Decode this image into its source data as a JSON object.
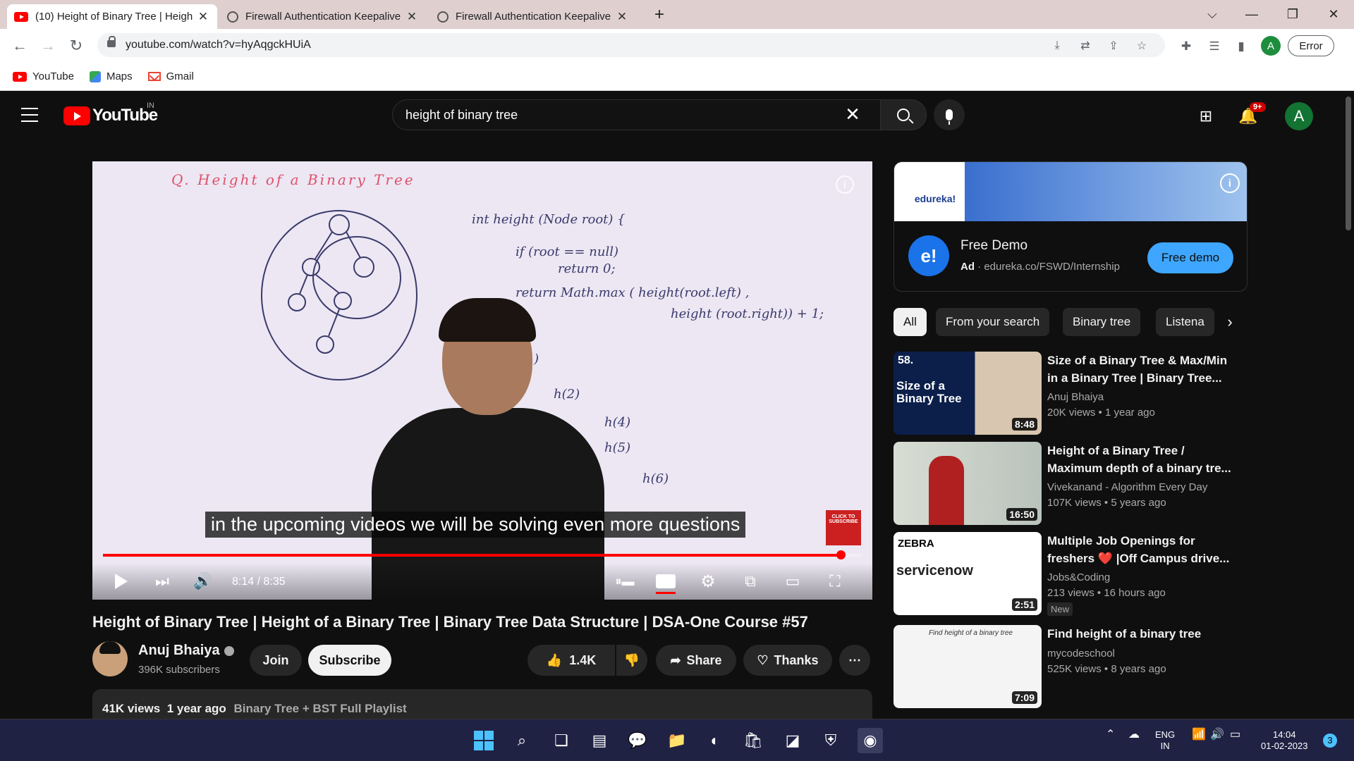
{
  "browser": {
    "tabs": [
      {
        "title": "(10) Height of Binary Tree | Heigh",
        "active": true
      },
      {
        "title": "Firewall Authentication Keepalive",
        "active": false
      },
      {
        "title": "Firewall Authentication Keepalive",
        "active": false
      }
    ],
    "new_tab": "+",
    "url": "youtube.com/watch?v=hyAqgckHUiA",
    "profile_initial": "A",
    "error_label": "Error",
    "bookmarks": [
      {
        "label": "YouTube",
        "icon": "youtube-icon"
      },
      {
        "label": "Maps",
        "icon": "maps-icon"
      },
      {
        "label": "Gmail",
        "icon": "gmail-icon"
      }
    ]
  },
  "header": {
    "logo_text": "YouTube",
    "country": "IN",
    "search_value": "height of binary tree",
    "notifications": "9+",
    "avatar_initial": "A"
  },
  "player": {
    "whiteboard_title": "Q. Height of a Binary Tree",
    "whiteboard_code": [
      "int height (Node root) {",
      "if (root == null)",
      "return 0;",
      "return Math.max ( height(root.left) ,",
      "height (root.right)) + 1;"
    ],
    "whiteboard_calls": [
      "h(1)",
      "h(2)",
      "h(4)",
      "h(5)",
      "h(6)"
    ],
    "caption": "in the upcoming videos we will be solving even more questions",
    "subscribe_overlay": "CLICK TO SUBSCRIBE",
    "current_time": "8:14",
    "duration": "8:35",
    "progress": 0.9725
  },
  "video": {
    "title": "Height of Binary Tree | Height of a Binary Tree | Binary Tree Data Structure | DSA-One Course #57",
    "channel": "Anuj Bhaiya",
    "subscribers": "396K subscribers",
    "join_label": "Join",
    "subscribe_label": "Subscribe",
    "likes": "1.4K",
    "share_label": "Share",
    "thanks_label": "Thanks",
    "views": "41K views",
    "age": "1 year ago",
    "playlist": "Binary Tree + BST Full Playlist"
  },
  "ad": {
    "brand": "edureka!",
    "title": "Free Demo",
    "ad_label": "Ad",
    "url": "edureka.co/FSWD/Internship",
    "cta": "Free demo",
    "icon_text": "e!"
  },
  "chips": [
    "All",
    "From your search",
    "Binary tree",
    "Listena"
  ],
  "recommendations": [
    {
      "title": "Size of a Binary Tree & Max/Min in a Binary Tree | Binary Tree...",
      "channel": "Anuj Bhaiya",
      "views": "20K views",
      "age": "1 year ago",
      "duration": "8:48",
      "thumb_text": "Size of a Binary Tree",
      "badge": "58.",
      "new": ""
    },
    {
      "title": "Height of a Binary Tree / Maximum depth of a binary tre...",
      "channel": "Vivekanand - Algorithm Every Day",
      "views": "107K views",
      "age": "5 years ago",
      "duration": "16:50",
      "thumb_text": "",
      "badge": "",
      "new": ""
    },
    {
      "title": "Multiple Job Openings for freshers ❤️ |Off Campus drive...",
      "channel": "Jobs&Coding",
      "views": "213 views",
      "age": "16 hours ago",
      "duration": "2:51",
      "thumb_text": "servicenow",
      "badge": "ZEBRA",
      "new": "New"
    },
    {
      "title": "Find height of a binary tree",
      "channel": "mycodeschool",
      "views": "525K views",
      "age": "8 years ago",
      "duration": "7:09",
      "thumb_text": "Find height of a binary tree",
      "badge": "",
      "new": ""
    }
  ],
  "taskbar": {
    "lang_1": "ENG",
    "lang_2": "IN",
    "time": "14:04",
    "date": "01-02-2023",
    "notif_count": "3"
  },
  "colors": {
    "accent_red": "#ff0000",
    "link_blue": "#3ea6ff",
    "bg": "#0f0f0f"
  }
}
